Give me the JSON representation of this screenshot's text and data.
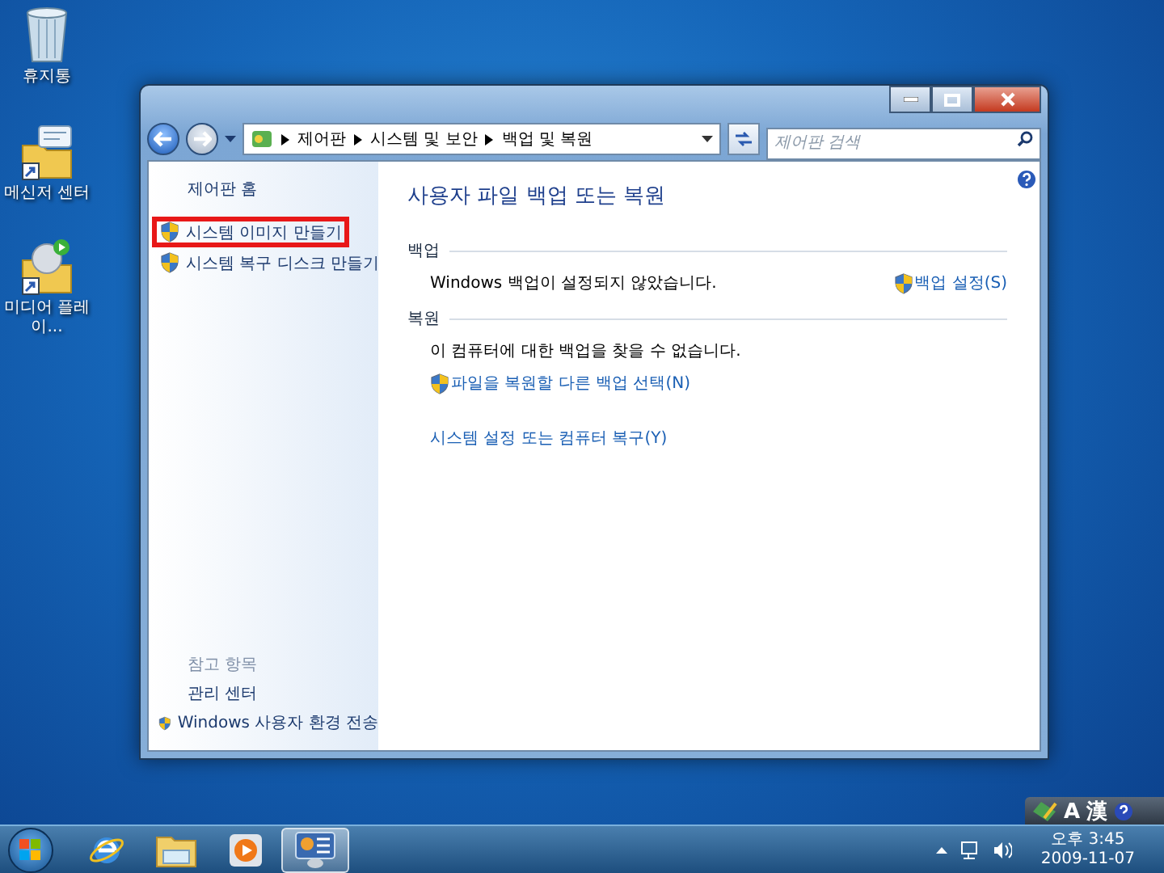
{
  "desktop_icons": [
    {
      "kind": "recycle",
      "label": "휴지통"
    },
    {
      "kind": "messenger",
      "label": "메신저 센터"
    },
    {
      "kind": "media",
      "label": "미디어 플레이..."
    }
  ],
  "window": {
    "breadcrumb": [
      "제어판",
      "시스템 및 보안",
      "백업 및 복원"
    ],
    "search": {
      "placeholder": "제어판 검색"
    },
    "sidebar": {
      "home": "제어판 홈",
      "tasks": [
        {
          "label": "시스템 이미지 만들기",
          "shield": true,
          "highlighted": true
        },
        {
          "label": "시스템 복구 디스크 만들기",
          "shield": true,
          "highlighted": false
        }
      ],
      "see_also": {
        "heading": "참고 항목",
        "links": [
          {
            "label": "관리 센터",
            "shield": false
          },
          {
            "label": "Windows 사용자 환경 전송",
            "shield": true
          }
        ]
      }
    },
    "main": {
      "title": "사용자 파일 백업 또는 복원",
      "sections": [
        {
          "kind": "inline",
          "heading": "백업",
          "status": "Windows 백업이 설정되지 않았습니다.",
          "action": {
            "label": "백업 설정(S)",
            "shield": true
          }
        },
        {
          "kind": "stacked",
          "heading": "복원",
          "status": "이 컴퓨터에 대한 백업을 찾을 수 없습니다.",
          "action": {
            "label": "파일을 복원할 다른 백업 선택(N)",
            "shield": true
          }
        }
      ],
      "extra_link": "시스템 설정 또는 컴퓨터 복구(Y)"
    }
  },
  "language_bar": {
    "mode": "A",
    "hanja": "漢"
  },
  "taskbar": {
    "apps": [
      {
        "kind": "browser",
        "selected": false
      },
      {
        "kind": "folder",
        "selected": false
      },
      {
        "kind": "player",
        "selected": false
      },
      {
        "kind": "control",
        "selected": true
      }
    ],
    "clock": {
      "time": "오후 3:45",
      "date": "2009-11-07"
    }
  }
}
